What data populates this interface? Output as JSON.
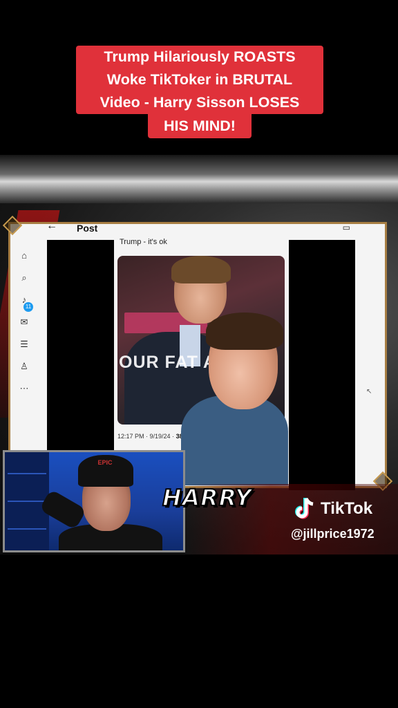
{
  "title": {
    "lines": [
      "Trump Hilariously ROASTS",
      "Woke TikToker in BRUTAL",
      "Video - Harry Sisson LOSES",
      "HIS MIND!"
    ]
  },
  "screen": {
    "header": {
      "back_icon": "arrow-left-icon",
      "label": "Post"
    },
    "tweet_text": "Trump - it's ok",
    "media_overlay_text": "OUR FAT A",
    "meta_time": "12:17 PM · 9/19/24 ·",
    "meta_views": "38K",
    "notification_count": "11",
    "rail_icons": [
      "home-icon",
      "search-icon",
      "bell-icon",
      "mail-icon",
      "list-icon",
      "person-icon",
      "more-icon"
    ]
  },
  "cam": {
    "cap_text": "EPIC"
  },
  "name_label": "HARRY",
  "watermark": {
    "brand": "TikTok",
    "handle": "@jillprice1972"
  },
  "colors": {
    "title_bg": "#e0313a",
    "frame_border": "#a77e43",
    "tiktok_cyan": "#25f4ee",
    "tiktok_red": "#fe2c55"
  }
}
